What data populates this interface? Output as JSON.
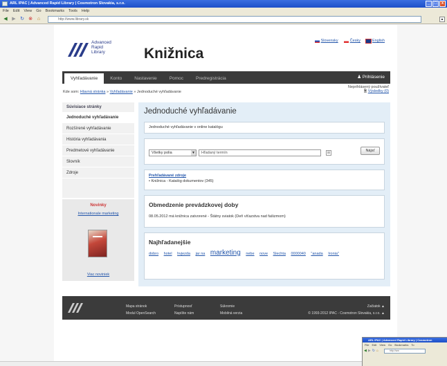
{
  "window": {
    "title": "ARL IPAC | Advanced Rapid Library | Cosmotron Slovakia, s.r.o.",
    "minimize": "_",
    "maximize": "□",
    "close": "x"
  },
  "menubar": [
    "File",
    "Edit",
    "View",
    "Go",
    "Bookmarks",
    "Tools",
    "Help"
  ],
  "navbar": {
    "address": "http://www.library.sk"
  },
  "logo": {
    "line1": "Advanced",
    "line2": "Rapid",
    "line3": "Library"
  },
  "site_title": "Knižnica",
  "languages": [
    "Slovensky",
    "Česky",
    "English"
  ],
  "tabs": [
    "Vyhľadávanie",
    "Konto",
    "Nastavenie",
    "Pomoc",
    "Predregistrácia"
  ],
  "login": "Prihlásenie",
  "breadcrumb": {
    "prefix": "Kde som:",
    "home": "Hlavná stránka",
    "sep": "»",
    "search": "Vyhľadávanie",
    "current": "Jednoduché vyhľadávanie"
  },
  "user": {
    "status": "Neprihlásený používateľ",
    "basket": "Výsledky (0)"
  },
  "sidebar": {
    "heading": "Súvisiace stránky",
    "items": [
      "Jednoduché vyhľadávanie",
      "Rozšírené vyhľadávanie",
      "História vyhľadávania",
      "Predmetové vyhľadávanie",
      "Slovník",
      "Zdroje"
    ],
    "news_heading": "Novinky",
    "news_link": "Internationale marketing",
    "news_more": "Viac noviniek"
  },
  "main": {
    "title": "Jednoduché vyhľadávanie",
    "intro": "Jednoduché vyhľadávanie v online katalógu",
    "select_value": "Všetky polia",
    "search_placeholder": "Hľadaný termín",
    "search_button": "Nájsť",
    "sources_link": "Prehľadávané zdroje",
    "sources_item": "• Knižnica - Katalóg dokumentov (345)",
    "notice_title": "Obmedzenie prevádzkovej doby",
    "notice_text": "08.05.2012 má knižnica zatvorené - Štátny sviatok (Deň víťazstva nad fašizmom)",
    "popular_title": "Najhľadanejšie",
    "popular_terms": [
      "dobro",
      "hotel",
      "hvjezda",
      "jar na",
      "marketing",
      "nebe",
      "nove",
      "Slechta",
      "0000040",
      "\"anada",
      "Ironia\""
    ]
  },
  "footer": {
    "col1": [
      "Mapa stránok",
      "Modul OpenSearch"
    ],
    "col2": [
      "Prístupnosť",
      "Napíšte nám"
    ],
    "col3": [
      "Súkromie",
      "Mobilná verzia"
    ],
    "top": "Začiatok ▲",
    "copyright": "© 1993-2012 IPAC - Cosmotron Slovakia, s.r.o. ▲"
  },
  "thumbnail": {
    "title": "ARL IPAC | Advanced Rapid Library | Cosmotron",
    "menu": [
      "File",
      "Edit",
      "View",
      "Go",
      "Bookmarks",
      "To"
    ],
    "address": "http://ww"
  },
  "colors": {
    "nav_dark": "#3b3b3b",
    "panel_blue": "#e3eef7",
    "link": "#2255aa",
    "title_blue": "#1c4fc8"
  }
}
